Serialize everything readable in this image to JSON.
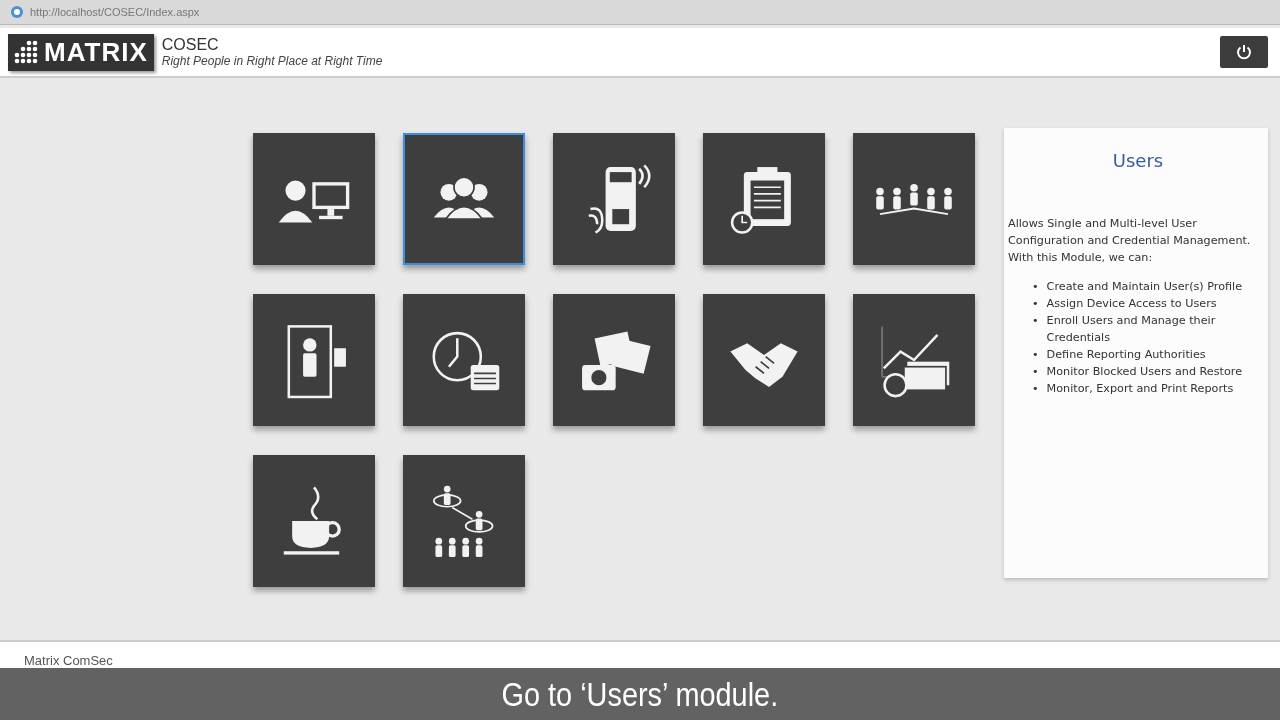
{
  "browser": {
    "address": "http://localhost/COSEC/Index.aspx"
  },
  "header": {
    "logo": "MATRIX",
    "title": "COSEC",
    "tagline": "Right People in Right Place at Right Time"
  },
  "modules": [
    {
      "kind": "operator",
      "selected": false
    },
    {
      "kind": "users",
      "selected": true
    },
    {
      "kind": "device",
      "selected": false
    },
    {
      "kind": "clipboard",
      "selected": false
    },
    {
      "kind": "hierarchy",
      "selected": false
    },
    {
      "kind": "door",
      "selected": false
    },
    {
      "kind": "schedule",
      "selected": false
    },
    {
      "kind": "photos",
      "selected": false
    },
    {
      "kind": "handshake",
      "selected": false
    },
    {
      "kind": "payroll",
      "selected": false
    },
    {
      "kind": "coffee",
      "selected": false
    },
    {
      "kind": "organization",
      "selected": false
    }
  ],
  "info_panel": {
    "title": "Users",
    "description": "Allows Single and Multi-level User Configuration and Credential Management.",
    "intro": "With this Module, we can:",
    "bullet": "•",
    "features": [
      "Create and Maintain User(s) Profile",
      "Assign Device Access to Users",
      "Enroll Users and Manage their Credentials",
      "Define Reporting Authorities",
      "Monitor Blocked Users and Restore",
      "Monitor, Export and Print Reports"
    ]
  },
  "footer": {
    "text": "Matrix ComSec"
  },
  "caption": "Go to ‘Users’ module."
}
